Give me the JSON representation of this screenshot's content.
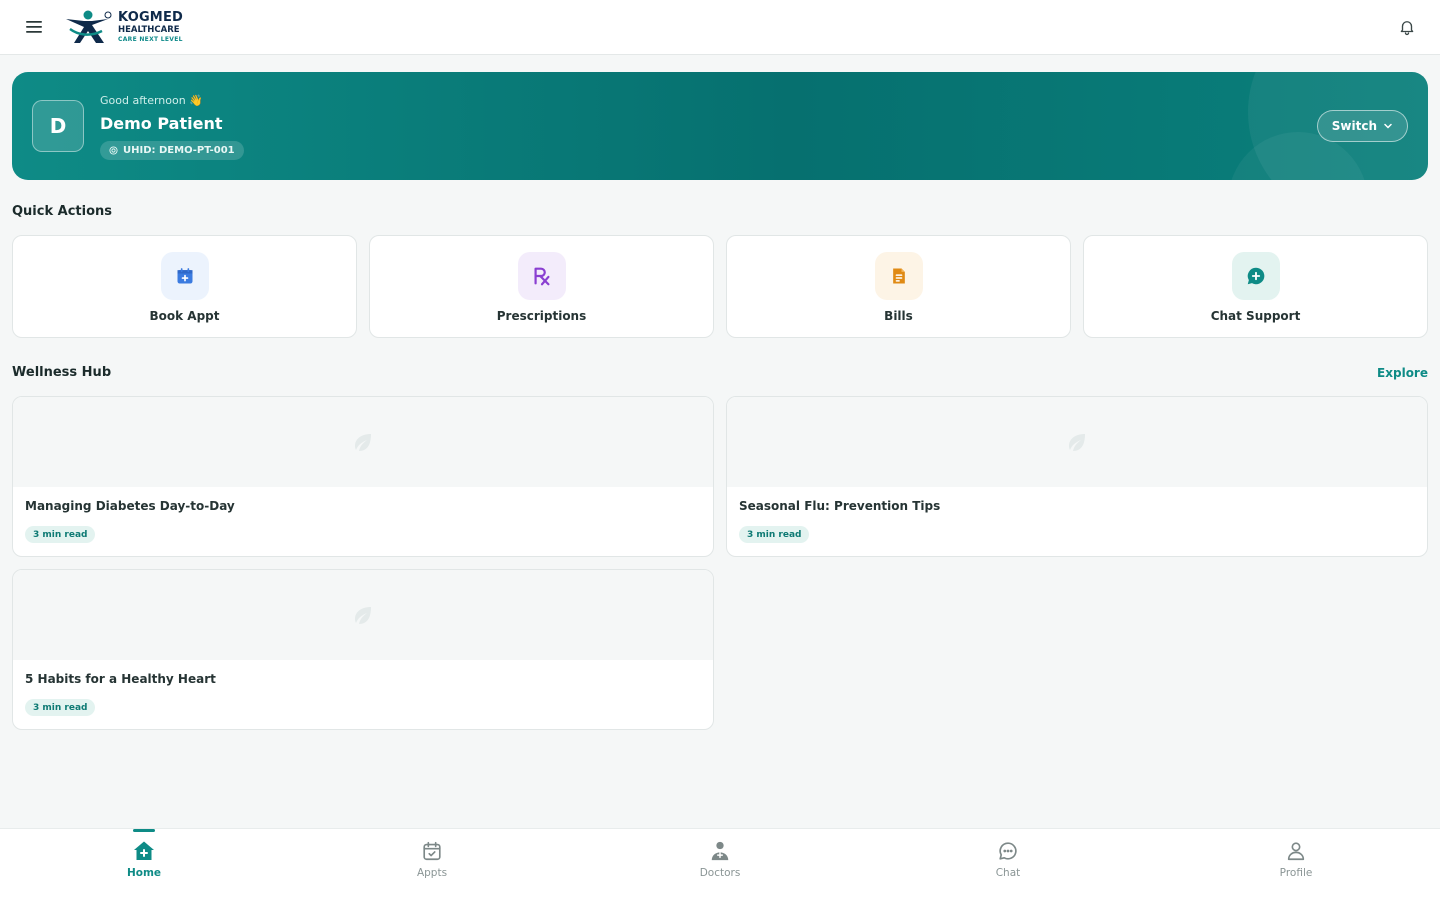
{
  "header": {
    "logo": {
      "name": "KOGMED",
      "sub": "HEALTHCARE",
      "tagline": "CARE NEXT LEVEL"
    },
    "menu_icon": "hamburger-icon",
    "bell_icon": "bell-icon"
  },
  "hero": {
    "avatar_initial": "D",
    "greeting": "Good afternoon 👋",
    "patient_name": "Demo Patient",
    "uhid": "UHID: DEMO-PT-001",
    "switch_label": "Switch",
    "colors": {
      "start": "#0e8b86",
      "end": "#06706f"
    }
  },
  "quick_actions": {
    "title": "Quick Actions",
    "items": [
      {
        "label": "Book Appt",
        "icon": "calendar-plus-icon",
        "color": "#3b7be0",
        "bg": "#ecf3fd"
      },
      {
        "label": "Prescriptions",
        "icon": "rx-icon",
        "color": "#8a3fd1",
        "bg": "#f3ecfb"
      },
      {
        "label": "Bills",
        "icon": "receipt-icon",
        "color": "#e08a14",
        "bg": "#fdf4e6"
      },
      {
        "label": "Chat Support",
        "icon": "chat-plus-icon",
        "color": "#0e8b86",
        "bg": "#e3f3f0"
      }
    ]
  },
  "wellness": {
    "title": "Wellness Hub",
    "explore_label": "Explore",
    "articles": [
      {
        "title": "Managing Diabetes Day-to-Day",
        "read_time": "3 min read"
      },
      {
        "title": "Seasonal Flu: Prevention Tips",
        "read_time": "3 min read"
      },
      {
        "title": "5 Habits for a Healthy Heart",
        "read_time": "3 min read"
      }
    ]
  },
  "bottom_nav": {
    "active": "Home",
    "items": [
      {
        "label": "Home",
        "icon": "home-plus-icon"
      },
      {
        "label": "Appts",
        "icon": "calendar-check-icon"
      },
      {
        "label": "Doctors",
        "icon": "doctor-icon"
      },
      {
        "label": "Chat",
        "icon": "chat-bubble-icon"
      },
      {
        "label": "Profile",
        "icon": "user-icon"
      }
    ]
  },
  "colors": {
    "accent": "#0e8b86",
    "background": "#f5f7f7"
  }
}
